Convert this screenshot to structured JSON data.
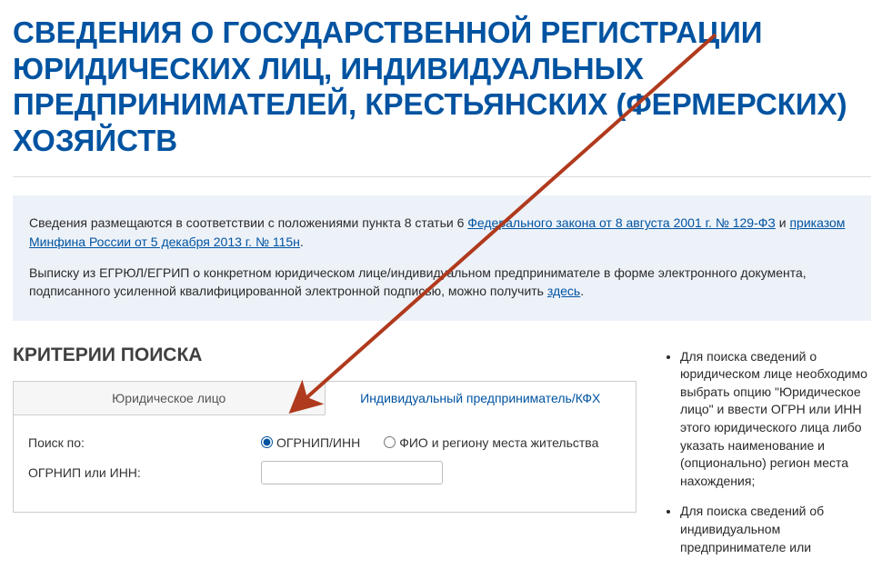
{
  "header": {
    "title": "Сведения о государственной регистрации юридических лиц, индивидуальных предпринимателей, крестьянских (фермерских) хозяйств"
  },
  "info": {
    "p1_before": "Сведения размещаются в соответствии с положениями пункта 8 статьи 6 ",
    "link1": "Федерального закона от 8 августа 2001 г. № 129-ФЗ",
    "p1_mid": " и ",
    "link2": "приказом Минфина России от 5 декабря 2013 г. № 115н",
    "p1_after": ".",
    "p2_before": "Выписку из ЕГРЮЛ/ЕГРИП о конкретном юридическом лице/индивидуальном предпринимателе в форме электронного документа, подписанного усиленной квалифицированной электронной подписью, можно получить ",
    "link3": "здесь",
    "p2_after": "."
  },
  "search": {
    "heading": "КРИТЕРИИ ПОИСКА",
    "tabs": {
      "tab1": "Юридическое лицо",
      "tab2": "Индивидуальный предприниматель/КФХ"
    },
    "form": {
      "search_by_label": "Поиск по:",
      "radio1": "ОГРНИП/ИНН",
      "radio2": "ФИО и региону места жительства",
      "ogrnip_label": "ОГРНИП или ИНН:",
      "ogrnip_value": ""
    }
  },
  "hints": {
    "item1": "Для поиска сведений о юридическом лице необходимо выбрать опцию \"Юридическое лицо\" и ввести ОГРН или ИНН этого юридического лица либо указать наименование и (опционально) регион места нахождения;",
    "item2": "Для поиска сведений об индивидуальном предпринимателе или"
  },
  "annotation": {
    "arrow_color": "#b03a1d"
  }
}
